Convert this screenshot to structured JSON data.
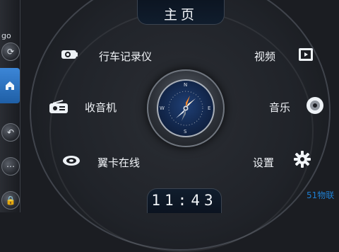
{
  "header": {
    "title": "主页"
  },
  "clock": {
    "time": "11:43"
  },
  "left_rail": {
    "partial_text": "go"
  },
  "menu": {
    "dvr": {
      "label": "行车记录仪",
      "icon": "dashcam-icon"
    },
    "video": {
      "label": "视频",
      "icon": "video-icon"
    },
    "radio": {
      "label": "收音机",
      "icon": "radio-icon"
    },
    "music": {
      "label": "音乐",
      "icon": "music-disc-icon"
    },
    "online": {
      "label": "翼卡在线",
      "icon": "wing-card-icon"
    },
    "settings": {
      "label": "设置",
      "icon": "gear-icon"
    }
  },
  "compass": {
    "letters": [
      "N",
      "E",
      "S",
      "W"
    ]
  },
  "watermark": {
    "text": "51物联"
  },
  "colors": {
    "accent_blue": "#2f7ad0",
    "panel_bg": "#1b1d22",
    "text_primary": "#f1f4f8"
  }
}
